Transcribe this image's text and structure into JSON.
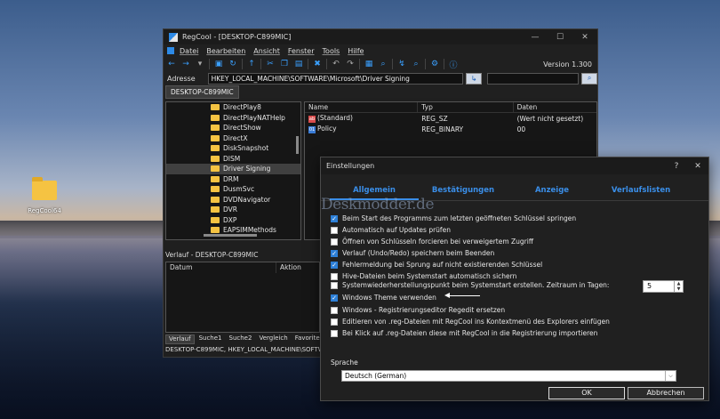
{
  "desktop": {
    "icon_label": "RegCool64"
  },
  "window": {
    "title": "RegCool - [DESKTOP-C899MIC]",
    "controls": [
      "—",
      "☐",
      "✕"
    ],
    "menu": [
      "Datei",
      "Bearbeiten",
      "Ansicht",
      "Fenster",
      "Tools",
      "Hilfe"
    ],
    "version": "Version 1.300",
    "address_label": "Adresse",
    "address_value": "HKEY_LOCAL_MACHINE\\SOFTWARE\\Microsoft\\Driver Signing",
    "machine_tab": "DESKTOP-C899MIC",
    "tree_items": [
      "DirectPlay8",
      "DirectPlayNATHelp",
      "DirectShow",
      "DirectX",
      "DiskSnapshot",
      "DISM",
      "Driver Signing",
      "DRM",
      "DusmSvc",
      "DVDNavigator",
      "DVR",
      "DXP",
      "EAPSIMMethods"
    ],
    "tree_selected_index": 6,
    "values_columns": [
      "Name",
      "Typ",
      "Daten"
    ],
    "values_rows": [
      {
        "name": "(Standard)",
        "type": "REG_SZ",
        "data": "(Wert nicht gesetzt)",
        "icon": "ab"
      },
      {
        "name": "Policy",
        "type": "REG_BINARY",
        "data": "00",
        "icon": "bin"
      }
    ],
    "history_title": "Verlauf - DESKTOP-C899MIC",
    "history_columns": [
      "Datum",
      "Aktion"
    ],
    "history_tabs": [
      "Verlauf",
      "Suche1",
      "Suche2",
      "Vergleich",
      "Favoriten",
      "F"
    ],
    "status": "DESKTOP-C899MIC, HKEY_LOCAL_MACHINE\\SOFTWA"
  },
  "dialog": {
    "title": "Einstellungen",
    "help": "?",
    "close": "✕",
    "tabs": [
      "Allgemein",
      "Bestätigungen",
      "Anzeige",
      "Verlaufslisten"
    ],
    "watermark": "Deskmodder.de",
    "options": [
      {
        "label": "Beim Start des Programms zum letzten geöffneten Schlüssel springen",
        "checked": true
      },
      {
        "label": "Automatisch auf Updates prüfen",
        "checked": false
      },
      {
        "label": "Öffnen von Schlüsseln forcieren bei verweigertem Zugriff",
        "checked": false
      },
      {
        "label": "Verlauf (Undo/Redo) speichern beim Beenden",
        "checked": true
      },
      {
        "label": "Fehlermeldung bei Sprung auf nicht existierenden Schlüssel",
        "checked": true
      },
      {
        "label": "Hive-Dateien beim Systemstart automatisch sichern",
        "checked": false
      },
      {
        "label": "Systemwiederherstellungspunkt beim Systemstart erstellen. Zeitraum in Tagen:",
        "checked": false
      },
      {
        "label": "Windows Theme verwenden",
        "checked": true
      },
      {
        "label": "Windows - Registrierungseditor Regedit ersetzen",
        "checked": false
      },
      {
        "label": "Editieren von .reg-Dateien mit RegCool ins Kontextmenü des Explorers einfügen",
        "checked": false
      },
      {
        "label": "Bei Klick auf .reg-Dateien diese mit RegCool in die Registrierung importieren",
        "checked": false
      }
    ],
    "days_value": "5",
    "language_label": "Sprache",
    "language_value": "Deutsch (German)",
    "ok_label": "OK",
    "cancel_label": "Abbrechen"
  }
}
